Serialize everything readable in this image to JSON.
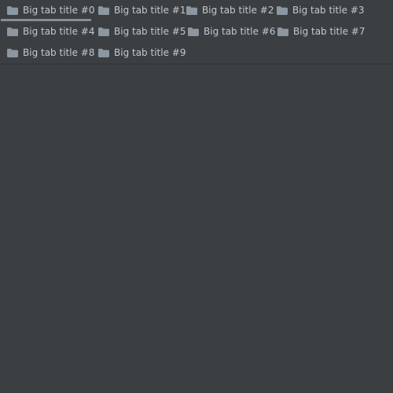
{
  "colors": {
    "background": "#3b3f42",
    "tab_text": "#c4c8cb",
    "folder_icon": "#8c97a1",
    "active_indicator": "#8a8d8f"
  },
  "tabs": [
    {
      "label": "Big tab title #0",
      "icon": "folder-icon",
      "active": true
    },
    {
      "label": "Big tab title #1",
      "icon": "folder-icon",
      "active": false
    },
    {
      "label": "Big tab title #2",
      "icon": "folder-icon",
      "active": false
    },
    {
      "label": "Big tab title #3",
      "icon": "folder-icon",
      "active": false
    },
    {
      "label": "Big tab title #4",
      "icon": "folder-icon",
      "active": false
    },
    {
      "label": "Big tab title #5",
      "icon": "folder-icon",
      "active": false
    },
    {
      "label": "Big tab title #6",
      "icon": "folder-icon",
      "active": false
    },
    {
      "label": "Big tab title #7",
      "icon": "folder-icon",
      "active": false
    },
    {
      "label": "Big tab title #8",
      "icon": "folder-icon",
      "active": false
    },
    {
      "label": "Big tab title #9",
      "icon": "folder-icon",
      "active": false
    }
  ]
}
